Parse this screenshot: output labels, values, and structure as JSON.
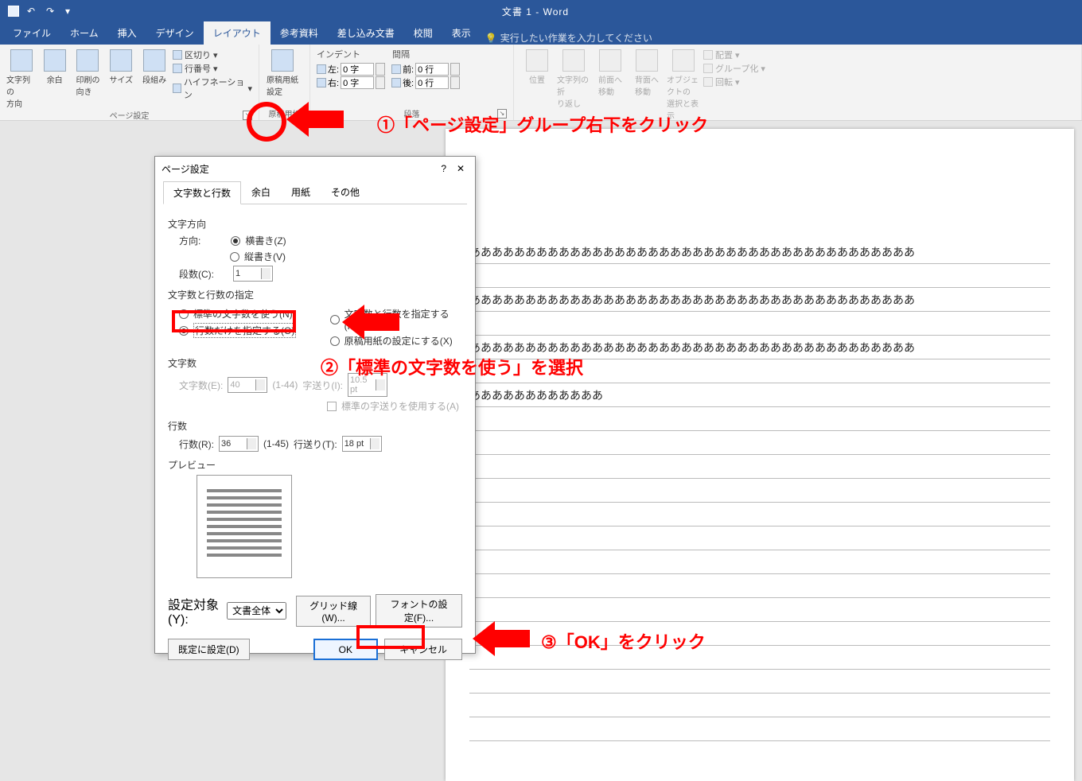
{
  "titlebar": {
    "doc_title": "文書 1  -  Word"
  },
  "tabs": {
    "file": "ファイル",
    "home": "ホーム",
    "insert": "挿入",
    "design": "デザイン",
    "layout": "レイアウト",
    "references": "参考資料",
    "mailings": "差し込み文書",
    "review": "校閲",
    "view": "表示",
    "tellme": "実行したい作業を入力してください"
  },
  "ribbon": {
    "page_setup": {
      "text_direction": "文字列の\n方向",
      "margins": "余白",
      "orientation": "印刷の\n向き",
      "size": "サイズ",
      "columns": "段組み",
      "breaks": "区切り",
      "line_numbers": "行番号",
      "hyphenation": "ハイフネーション",
      "group": "ページ設定"
    },
    "genkou": {
      "btn": "原稿用紙\n設定",
      "group": "原稿用紙"
    },
    "para": {
      "indent_h": "インデント",
      "left_l": "左:",
      "left_v": "0 字",
      "right_l": "右:",
      "right_v": "0 字",
      "spacing_h": "間隔",
      "before_l": "前:",
      "before_v": "0 行",
      "after_l": "後:",
      "after_v": "0 行",
      "group": "段落"
    },
    "arrange": {
      "position": "位置",
      "wrap": "文字列の折\nり返し",
      "bring_fwd": "前面へ\n移動",
      "send_back": "背面へ\n移動",
      "selection_pane": "オブジェクトの\n選択と表示",
      "align": "配置",
      "group_obj": "グループ化",
      "rotate": "回転"
    }
  },
  "dialog": {
    "title": "ページ設定",
    "tabs": {
      "t1": "文字数と行数",
      "t2": "余白",
      "t3": "用紙",
      "t4": "その他"
    },
    "text_dir_h": "文字方向",
    "dir_label": "方向:",
    "horiz": "横書き(Z)",
    "vert": "縦書き(V)",
    "cols_label": "段数(C):",
    "cols_val": "1",
    "spec_h": "文字数と行数の指定",
    "opt_default": "標準の文字数を使う(N)",
    "opt_lines": "行数だけを指定する(O)",
    "opt_both": "文字数と行数を指定する(H)",
    "opt_grid": "原稿用紙の設定にする(X)",
    "chars_h": "文字数",
    "chars_label": "文字数(E):",
    "chars_val": "40",
    "chars_range": "(1-44)",
    "pitch_label": "字送り(I):",
    "pitch_val": "10.5 pt",
    "std_pitch": "標準の字送りを使用する(A)",
    "lines_h": "行数",
    "lines_label": "行数(R):",
    "lines_val": "36",
    "lines_range": "(1-45)",
    "line_pitch_label": "行送り(T):",
    "line_pitch_val": "18 pt",
    "preview_h": "プレビュー",
    "apply_label": "設定対象(Y):",
    "apply_val": "文書全体",
    "grid_btn": "グリッド線(W)...",
    "font_btn": "フォントの設定(F)...",
    "default_btn": "既定に設定(D)",
    "ok": "OK",
    "cancel": "キャンセル"
  },
  "doc_line": "ああああああああああああああああああああああああああああああああああああああああ",
  "doc_line_short": "ああああああああああああ",
  "anno": {
    "a1": "①「ページ設定」グループ右下をクリック",
    "a2": "②「標準の文字数を使う」を選択",
    "a3": "③「OK」をクリック"
  }
}
